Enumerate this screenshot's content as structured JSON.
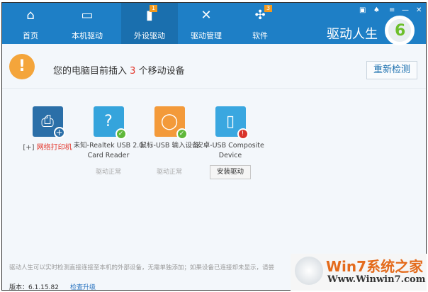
{
  "header": {
    "tabs": [
      {
        "label": "首页",
        "icon": "home-icon"
      },
      {
        "label": "本机驱动",
        "icon": "monitor-icon"
      },
      {
        "label": "外设驱动",
        "icon": "usb-icon",
        "badge": "1",
        "active": true
      },
      {
        "label": "驱动管理",
        "icon": "tools-icon"
      },
      {
        "label": "软件",
        "icon": "apps-icon",
        "badge": "3"
      }
    ],
    "brand": "驱动人生",
    "logo_digit": "6"
  },
  "alert": {
    "prefix": "您的电脑目前插入",
    "count": "3",
    "suffix": "个移动设备",
    "recheck": "重新检测"
  },
  "devices": [
    {
      "name": "网络打印机",
      "add_icon": "[+]",
      "color": "#2b6fa8"
    },
    {
      "name": "未知-Realtek USB 2.0 Card Reader",
      "status": "驱动正常",
      "color": "#35a4dc"
    },
    {
      "name": "鼠标-USB 输入设备",
      "status": "驱动正常",
      "color": "#f39a3a"
    },
    {
      "name": "安卓-USB Composite Device",
      "action": "安装驱动",
      "color": "#3aa7e0"
    }
  ],
  "footer": {
    "tip": "驱动人生可以实时检测直接连接至本机的外部设备，无需单独添加；如果设备已连接却未显示，请尝",
    "version": "版本：6.1.15.82",
    "check_update": "检查升级"
  },
  "watermark": {
    "title": "Win7系统之家",
    "url": "Www.Winwin7.com"
  }
}
